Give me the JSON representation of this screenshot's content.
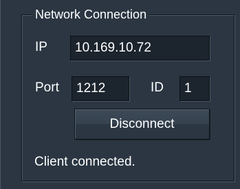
{
  "group": {
    "title": "Network Connection"
  },
  "ip": {
    "label": "IP",
    "value": "10.169.10.72"
  },
  "port": {
    "label": "Port",
    "value": "1212"
  },
  "id": {
    "label": "ID",
    "value": "1"
  },
  "actions": {
    "disconnect_label": "Disconnect"
  },
  "status": {
    "text": "Client connected."
  },
  "colors": {
    "background": "#2b3642",
    "field_background": "#1c242d",
    "text": "#ffffff"
  }
}
